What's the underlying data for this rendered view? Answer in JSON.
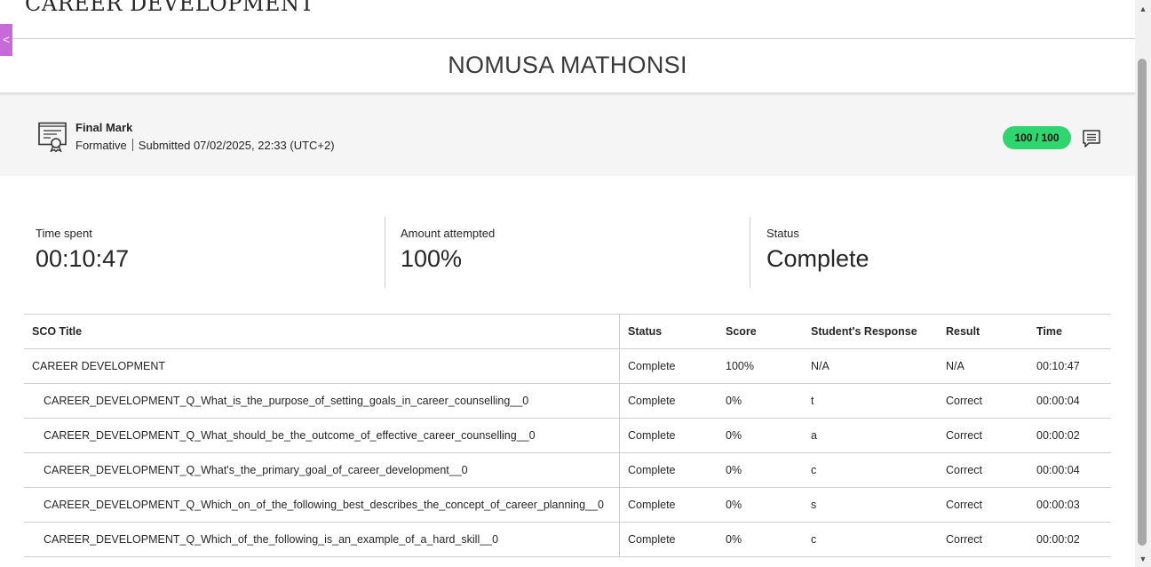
{
  "header": {
    "course_title": "CAREER DEVELOPMENT",
    "side_tab_glyph": "<"
  },
  "student": {
    "name": "NOMUSA MATHONSI"
  },
  "final_mark": {
    "label": "Final Mark",
    "type": "Formative",
    "submitted": "Submitted 07/02/2025, 22:33 (UTC+2)",
    "score": "100 / 100",
    "score_color": "#2fd66f"
  },
  "stats": {
    "time_spent": {
      "label": "Time spent",
      "value": "00:10:47"
    },
    "amount_attempted": {
      "label": "Amount attempted",
      "value": "100%"
    },
    "status": {
      "label": "Status",
      "value": "Complete"
    }
  },
  "table": {
    "headers": [
      "SCO Title",
      "Status",
      "Score",
      "Student's Response",
      "Result",
      "Time"
    ],
    "rows": [
      [
        "CAREER DEVELOPMENT",
        "Complete",
        "100%",
        "N/A",
        "N/A",
        "00:10:47"
      ],
      [
        "CAREER_DEVELOPMENT_Q_What_is_the_purpose_of_setting_goals_in_career_counselling__0",
        "Complete",
        "0%",
        "t",
        "Correct",
        "00:00:04"
      ],
      [
        "CAREER_DEVELOPMENT_Q_What_should_be_the_outcome_of_effective_career_counselling__0",
        "Complete",
        "0%",
        "a",
        "Correct",
        "00:00:02"
      ],
      [
        "CAREER_DEVELOPMENT_Q_What's_the_primary_goal_of_career_development__0",
        "Complete",
        "0%",
        "c",
        "Correct",
        "00:00:04"
      ],
      [
        "CAREER_DEVELOPMENT_Q_Which_on_of_the_following_best_describes_the_concept_of_career_planning__0",
        "Complete",
        "0%",
        "s",
        "Correct",
        "00:00:03"
      ],
      [
        "CAREER_DEVELOPMENT_Q_Which_of_the_following_is_an_example_of_a_hard_skill__0",
        "Complete",
        "0%",
        "c",
        "Correct",
        "00:00:02"
      ]
    ]
  },
  "icons": {
    "certificate": "certificate-icon",
    "comment": "comment-icon"
  }
}
